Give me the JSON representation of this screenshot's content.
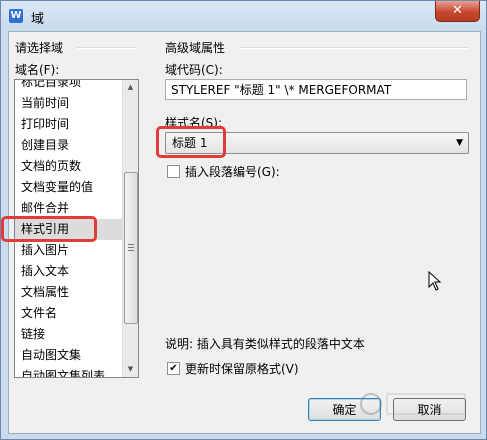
{
  "window": {
    "title": "域",
    "app_icon": "W",
    "close_glyph": "✕"
  },
  "left": {
    "group_title": "请选择域",
    "list_label": "域名(F):",
    "items": [
      "标记目录项",
      "当前时间",
      "打印时间",
      "创建目录",
      "文档的页数",
      "文档变量的值",
      "邮件合并",
      "样式引用",
      "插入图片",
      "插入文本",
      "文档属性",
      "文件名",
      "链接",
      "自动图文集",
      "自动图文集列表"
    ],
    "selected_index": 7
  },
  "right": {
    "group_title": "高级域属性",
    "code_label": "域代码(C):",
    "code_value": "STYLEREF \"标题 1\" \\* MERGEFORMAT",
    "style_label": "样式名(S):",
    "style_value": "标题 1",
    "insert_para_label": "插入段落编号(G):",
    "insert_para_checked": false,
    "description": "说明: 插入具有类似样式的段落中文本",
    "preserve_label": "更新时保留原格式(V)",
    "preserve_checked": true
  },
  "buttons": {
    "ok": "确定",
    "cancel": "取消"
  }
}
